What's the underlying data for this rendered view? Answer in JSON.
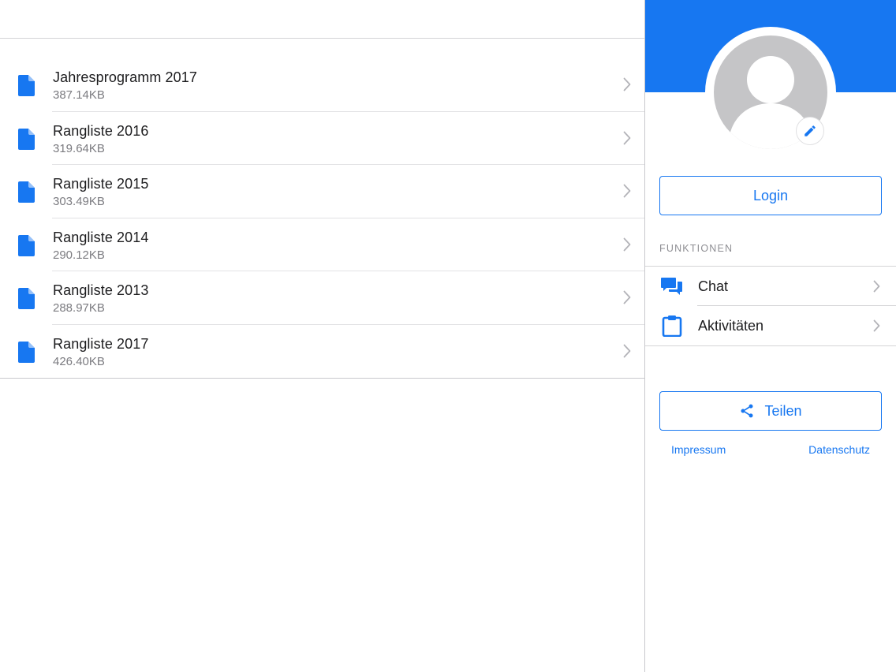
{
  "files": [
    {
      "name": "Jahresprogramm 2017",
      "size": "387.14KB"
    },
    {
      "name": "Rangliste 2016",
      "size": "319.64KB"
    },
    {
      "name": "Rangliste 2015",
      "size": "303.49KB"
    },
    {
      "name": "Rangliste 2014",
      "size": "290.12KB"
    },
    {
      "name": "Rangliste 2013",
      "size": "288.97KB"
    },
    {
      "name": "Rangliste 2017",
      "size": "426.40KB"
    }
  ],
  "sidebar": {
    "login_label": "Login",
    "section_label": "FUNKTIONEN",
    "functions": [
      {
        "label": "Chat",
        "icon": "chat-icon"
      },
      {
        "label": "Aktivitäten",
        "icon": "clipboard-icon"
      }
    ],
    "share_label": "Teilen",
    "links": {
      "impressum": "Impressum",
      "datenschutz": "Datenschutz"
    }
  },
  "colors": {
    "accent": "#1777f1",
    "avatar_placeholder": "#c5c5c7"
  }
}
